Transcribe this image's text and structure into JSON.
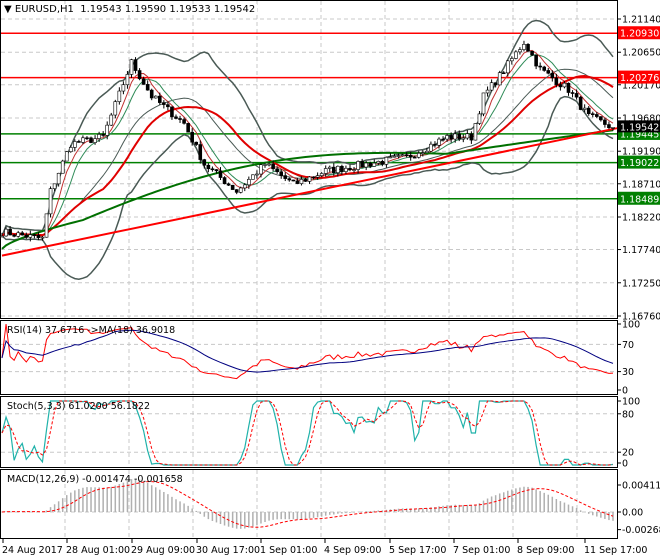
{
  "header": {
    "symbol": "EURUSD,H1",
    "open": "1.19543",
    "high": "1.19590",
    "low": "1.19533",
    "close": "1.19542"
  },
  "chart_data": {
    "type": "candlestick",
    "title": "EURUSD,H1",
    "price_axis_ticks": [
      "1.21140",
      "1.20650",
      "1.20170",
      "1.19680",
      "1.19190",
      "1.18710",
      "1.18220",
      "1.17740",
      "1.17250",
      "1.16760"
    ],
    "ylim": [
      1.1676,
      1.2114
    ],
    "time_labels": [
      "24 Aug 2017",
      "28 Aug 01:00",
      "29 Aug 09:00",
      "30 Aug 17:00",
      "1 Sep 01:00",
      "4 Sep 09:00",
      "5 Sep 17:00",
      "7 Sep 01:00",
      "8 Sep 09:00",
      "11 Sep 17:00"
    ],
    "bars": 152,
    "price_path": [
      [
        0,
        1.18
      ],
      [
        10,
        1.179
      ],
      [
        12,
        1.186
      ],
      [
        17,
        1.193
      ],
      [
        25,
        1.194
      ],
      [
        32,
        1.205
      ],
      [
        37,
        1.2
      ],
      [
        45,
        1.196
      ],
      [
        50,
        1.19
      ],
      [
        58,
        1.186
      ],
      [
        65,
        1.19
      ],
      [
        72,
        1.187
      ],
      [
        80,
        1.189
      ],
      [
        90,
        1.19
      ],
      [
        100,
        1.191
      ],
      [
        110,
        1.194
      ],
      [
        116,
        1.194
      ],
      [
        119,
        1.2
      ],
      [
        123,
        1.203
      ],
      [
        129,
        1.208
      ],
      [
        133,
        1.204
      ],
      [
        140,
        1.201
      ],
      [
        145,
        1.197
      ],
      [
        151,
        1.1954
      ]
    ],
    "levels": [
      {
        "price": "1.20930",
        "color": "#ff0000"
      },
      {
        "price": "1.20276",
        "color": "#ff0000"
      },
      {
        "price": "1.19445",
        "color": "#008000"
      },
      {
        "price": "1.19022",
        "color": "#008000"
      },
      {
        "price": "1.18489",
        "color": "#008000"
      }
    ],
    "current_price": "1.19542",
    "trendline": {
      "from": [
        0,
        1.1765
      ],
      "to": [
        151,
        1.1953
      ],
      "color": "#ff0000"
    },
    "rsi": {
      "label": "RSI(14) 37.6716  ->MA(18) 36.9018",
      "ticks": [
        "100",
        "70",
        "30",
        "0"
      ]
    },
    "stoch": {
      "label": "Stoch(5,3,3) 61.0200 56.1822",
      "ticks": [
        "100",
        "80",
        "20",
        "0"
      ]
    },
    "macd": {
      "label": "MACD(12,26,9) -0.001474 -0.001658",
      "ticks": [
        "0.004113",
        "0.00",
        "-0.002684"
      ]
    }
  }
}
